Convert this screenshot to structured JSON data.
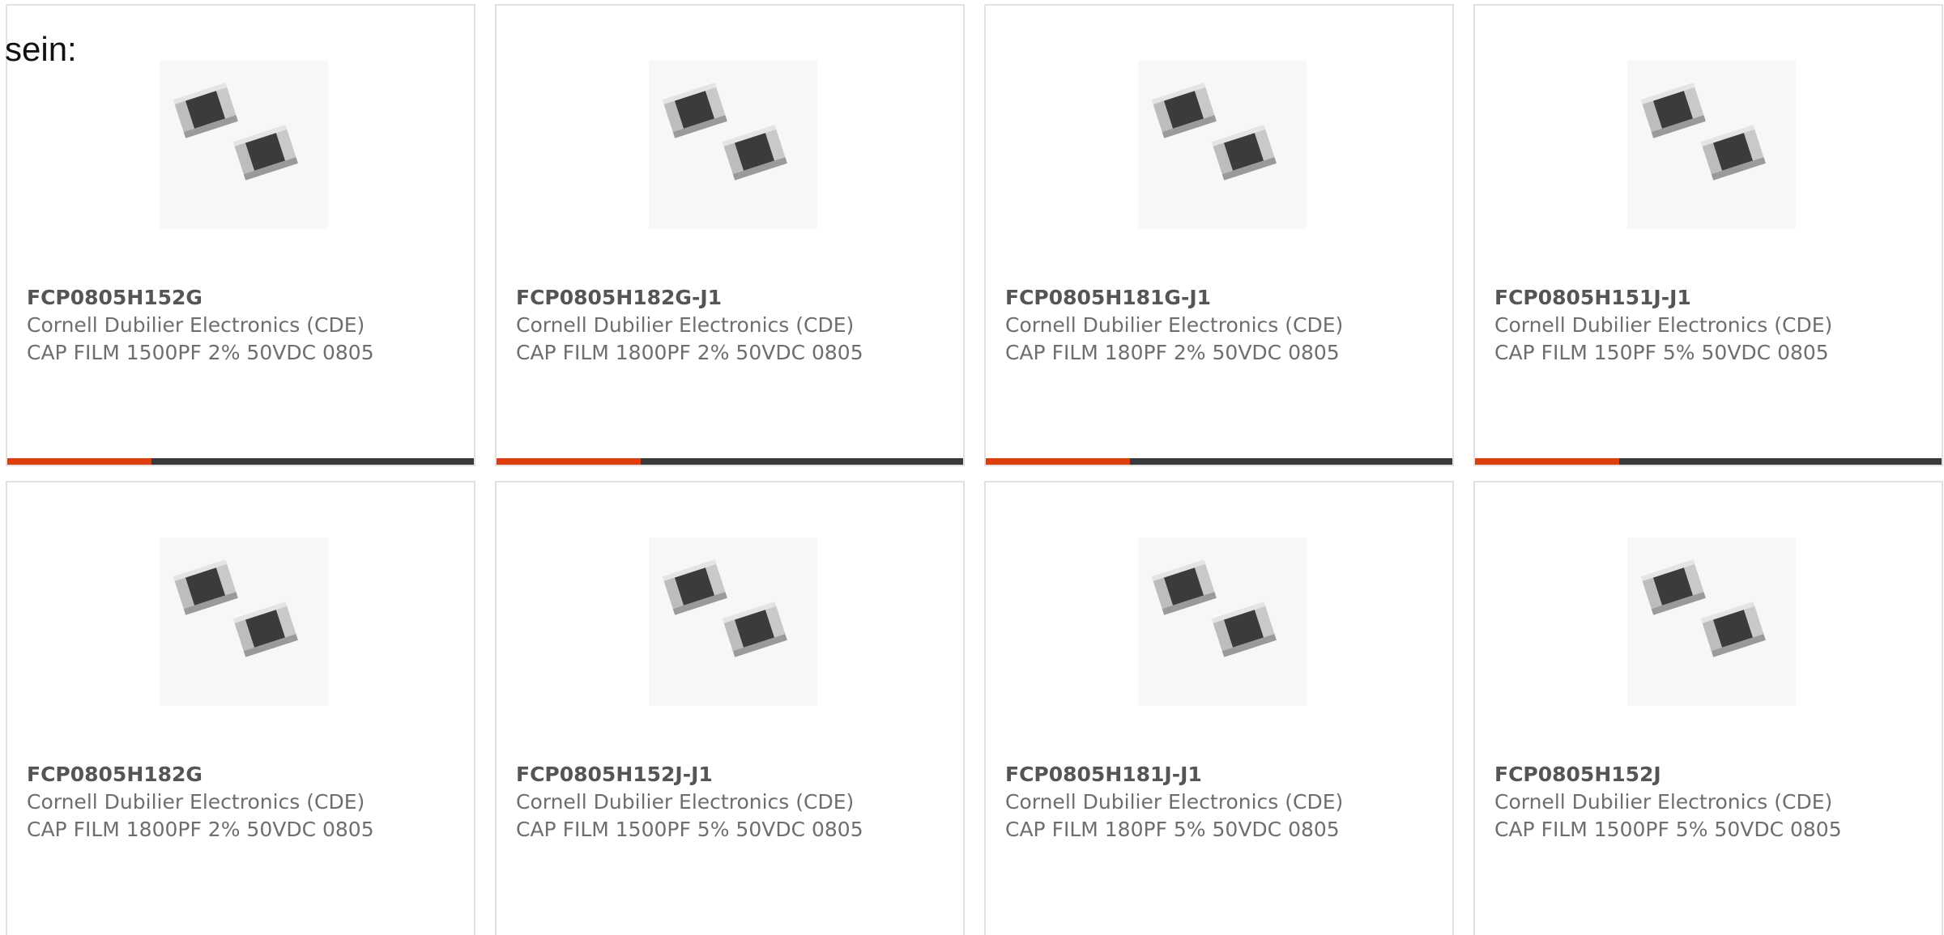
{
  "page": {
    "heading": "sein:"
  },
  "colors": {
    "accent": "#e03c0e",
    "bar_track": "#3a3a3a",
    "card_border": "#e1e1e1",
    "part_number": "#555555",
    "body_text": "#6e6e6e"
  },
  "products": [
    {
      "part_number": "FCP0805H152G",
      "manufacturer": "Cornell Dubilier Electronics (CDE)",
      "description": "CAP FILM 1500PF 2% 50VDC 0805",
      "image_icon": "smd-capacitor-image",
      "bar_fill": 0.31
    },
    {
      "part_number": "FCP0805H182G-J1",
      "manufacturer": "Cornell Dubilier Electronics (CDE)",
      "description": "CAP FILM 1800PF 2% 50VDC 0805",
      "image_icon": "smd-capacitor-image",
      "bar_fill": 0.31
    },
    {
      "part_number": "FCP0805H181G-J1",
      "manufacturer": "Cornell Dubilier Electronics (CDE)",
      "description": "CAP FILM 180PF 2% 50VDC 0805",
      "image_icon": "smd-capacitor-image",
      "bar_fill": 0.31
    },
    {
      "part_number": "FCP0805H151J-J1",
      "manufacturer": "Cornell Dubilier Electronics (CDE)",
      "description": "CAP FILM 150PF 5% 50VDC 0805",
      "image_icon": "smd-capacitor-image",
      "bar_fill": 0.31
    },
    {
      "part_number": "FCP0805H182G",
      "manufacturer": "Cornell Dubilier Electronics (CDE)",
      "description": "CAP FILM 1800PF 2% 50VDC 0805",
      "image_icon": "smd-capacitor-image"
    },
    {
      "part_number": "FCP0805H152J-J1",
      "manufacturer": "Cornell Dubilier Electronics (CDE)",
      "description": "CAP FILM 1500PF 5% 50VDC 0805",
      "image_icon": "smd-capacitor-image"
    },
    {
      "part_number": "FCP0805H181J-J1",
      "manufacturer": "Cornell Dubilier Electronics (CDE)",
      "description": "CAP FILM 180PF 5% 50VDC 0805",
      "image_icon": "smd-capacitor-image"
    },
    {
      "part_number": "FCP0805H152J",
      "manufacturer": "Cornell Dubilier Electronics (CDE)",
      "description": "CAP FILM 1500PF 5% 50VDC 0805",
      "image_icon": "smd-capacitor-image"
    }
  ]
}
